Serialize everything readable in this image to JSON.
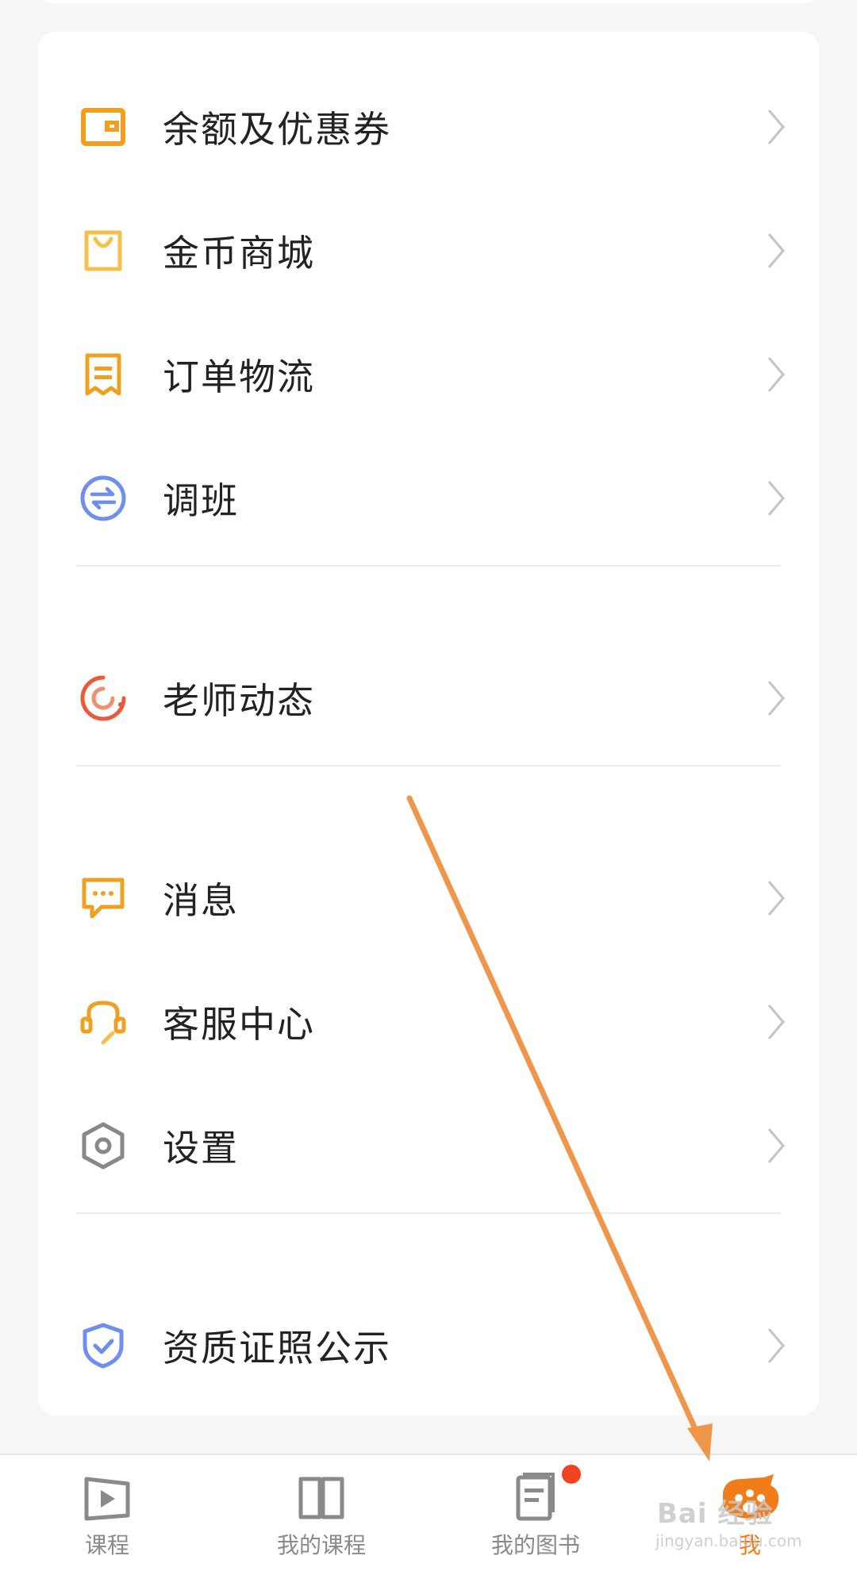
{
  "menu": {
    "group1": [
      {
        "label": "余额及优惠券",
        "icon": "wallet-icon"
      },
      {
        "label": "金币商城",
        "icon": "shopping-bag-icon"
      },
      {
        "label": "订单物流",
        "icon": "receipt-icon"
      },
      {
        "label": "调班",
        "icon": "swap-icon"
      }
    ],
    "group2": [
      {
        "label": "老师动态",
        "icon": "feed-icon"
      }
    ],
    "group3": [
      {
        "label": "消息",
        "icon": "message-icon"
      },
      {
        "label": "客服中心",
        "icon": "headset-icon"
      },
      {
        "label": "设置",
        "icon": "gear-icon"
      }
    ],
    "group4": [
      {
        "label": "资质证照公示",
        "icon": "shield-check-icon"
      }
    ]
  },
  "tabbar": {
    "tabs": [
      {
        "label": "课程",
        "icon": "play-icon",
        "active": false
      },
      {
        "label": "我的课程",
        "icon": "book-icon",
        "active": false
      },
      {
        "label": "我的图书",
        "icon": "document-icon",
        "active": false,
        "badge": true
      },
      {
        "label": "我",
        "icon": "profile-icon",
        "active": true
      }
    ]
  },
  "watermark": {
    "text": "Bai 经验",
    "sub": "jingyan.baidu.com"
  },
  "colors": {
    "accent": "#f07d1a",
    "orange_icon": "#f0a020",
    "blue_icon": "#6f8ff0",
    "red_icon": "#e85a3a",
    "gray_icon": "#888888",
    "annotation_arrow": "#f0964a",
    "badge": "#f0441e"
  }
}
